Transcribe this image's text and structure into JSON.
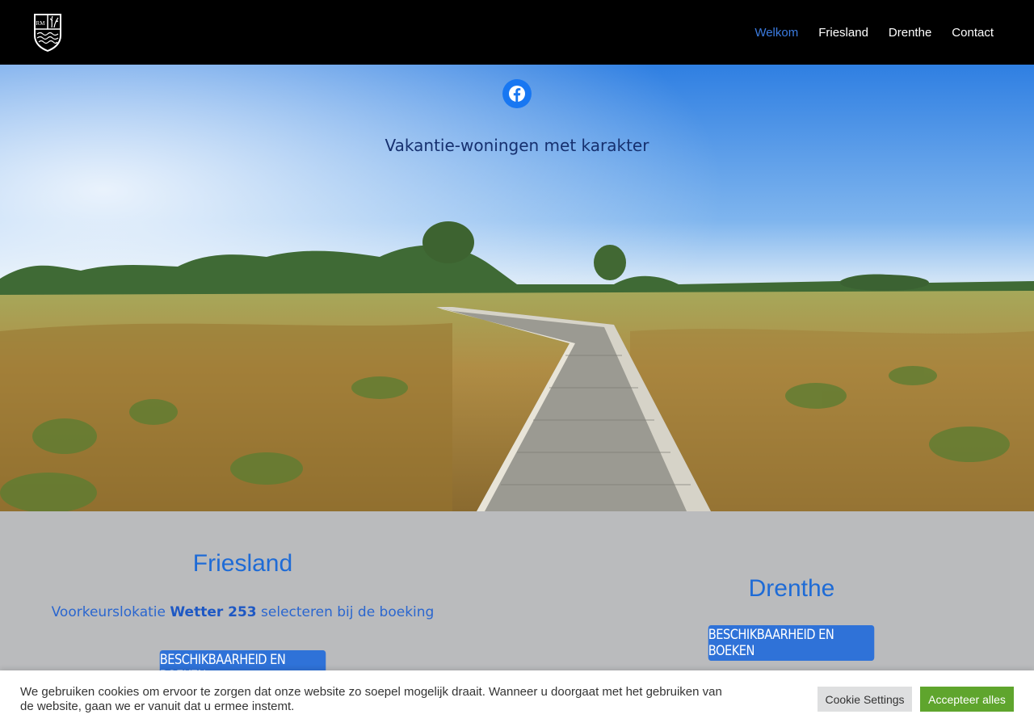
{
  "header": {
    "logo_text": "RM",
    "nav": [
      {
        "label": "Welkom",
        "active": true
      },
      {
        "label": "Friesland",
        "active": false
      },
      {
        "label": "Drenthe",
        "active": false
      },
      {
        "label": "Contact",
        "active": false
      }
    ]
  },
  "hero": {
    "social_icon": "facebook-icon",
    "title": "Vakantie-woningen met karakter"
  },
  "locations": {
    "friesland": {
      "title": "Friesland",
      "note_before": "Voorkeurslokatie ",
      "note_bold": "Wetter 253",
      "note_after": " selecteren bij de boeking",
      "button_label": "BESCHIKBAARHEID EN BOEKEN"
    },
    "drenthe": {
      "title": "Drenthe",
      "button_label": "BESCHIKBAARHEID EN BOEKEN"
    }
  },
  "cookie_bar": {
    "message": "We gebruiken cookies om ervoor te zorgen dat onze website zo soepel mogelijk draait. Wanneer u doorgaat met het gebruiken van de website, gaan we er vanuit dat u ermee instemt.",
    "settings_label": "Cookie Settings",
    "accept_label": "Accepteer alles"
  },
  "colors": {
    "nav_active": "#3b7be0",
    "accent_blue": "#1e6bd6",
    "button_blue": "#2f72d8",
    "accept_green": "#5fa52d"
  }
}
